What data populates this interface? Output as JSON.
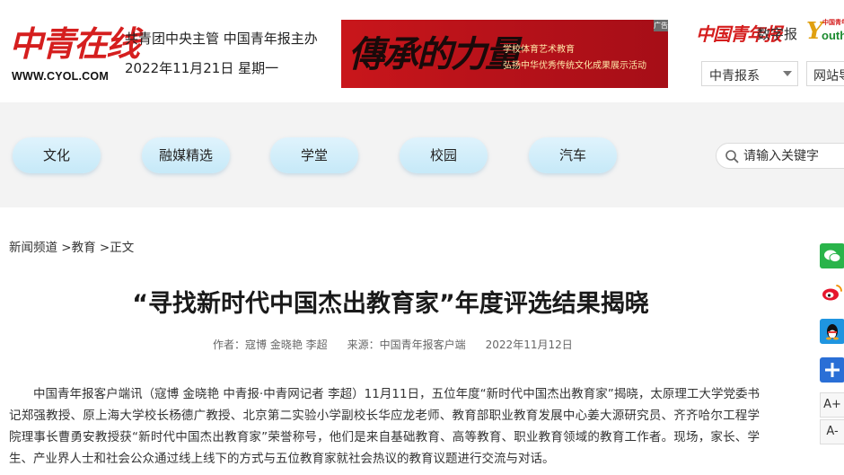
{
  "header": {
    "logo_text": "中青在线",
    "logo_url": "WWW.CYOL.COM",
    "sponsor": "共青团中央主管 中国青年报主办",
    "date": "2022年11月21日 星期一",
    "banner": {
      "calligraphy": "傳承的力量",
      "line1": "学校体育艺术教育",
      "line2": "弘扬中华优秀传统文化成果展示活动",
      "ad_tag": "广告"
    },
    "cyd_logo": "中国青年报",
    "cyd_digital": "数字报",
    "youth_small": "中国青年",
    "youth_y": "Y",
    "youth_rest": "outh",
    "select_label": "中青报系",
    "site_label": "网站导航"
  },
  "nav": {
    "items": [
      "文化",
      "融媒精选",
      "学堂",
      "校园",
      "汽车"
    ],
    "search_placeholder": "请输入关键字"
  },
  "breadcrumb": {
    "channel": "新闻频道",
    "sep1": " >",
    "section": "教育",
    "sep2": " >",
    "current": "正文"
  },
  "article": {
    "title": "“寻找新时代中国杰出教育家”年度评选结果揭晓",
    "author": "作者：寇博 金晓艳 李超",
    "source": "来源：中国青年报客户端",
    "date": "2022年11月12日",
    "body": "中国青年报客户端讯（寇博 金晓艳 中青报·中青网记者 李超）11月11日，五位年度“新时代中国杰出教育家”揭晓，太原理工大学党委书记郑强教授、原上海大学校长杨德广教授、北京第二实验小学副校长华应龙老师、教育部职业教育发展中心姜大源研究员、齐齐哈尔工程学院理事长曹勇安教授获“新时代中国杰出教育家”荣誉称号，他们是来自基础教育、高等教育、职业教育领域的教育工作者。现场，家长、学生、产业界人士和社会公众通过线上线下的方式与五位教育家就社会热议的教育议题进行交流与对话。"
  },
  "sidebar": {
    "font_up": "A+",
    "font_down": "A-"
  },
  "colors": {
    "brand_red": "#d51e1e",
    "nav_button": "#c6e9f8",
    "nav_band": "#f3f3f3"
  }
}
